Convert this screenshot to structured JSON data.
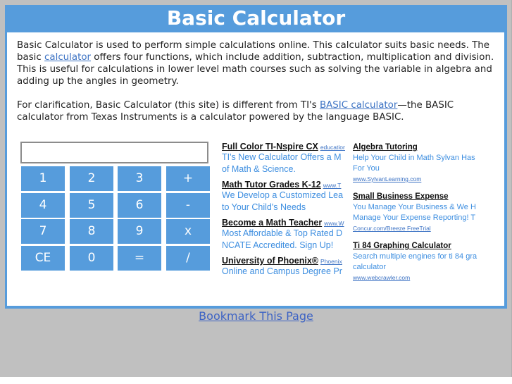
{
  "header": {
    "title": "Basic Calculator"
  },
  "intro": {
    "p1_before": "Basic Calculator is used to perform simple calculations online. This calculator suits basic needs. The basic ",
    "p1_link": "calculator",
    "p1_after": " offers four functions, which include addition, subtraction, multiplication and division. This is useful for calculations in lower level math courses such as solving the variable in algebra and adding up the angles in geometry.",
    "p2_before": "For clarification, Basic Calculator (this site) is different from TI's ",
    "p2_link": "BASIC calculator",
    "p2_after": "—the BASIC calculator from Texas Instruments is a calculator powered by the language BASIC."
  },
  "calculator": {
    "display_value": "",
    "keys": [
      [
        "1",
        "2",
        "3",
        "+"
      ],
      [
        "4",
        "5",
        "6",
        "-"
      ],
      [
        "7",
        "8",
        "9",
        "x"
      ],
      [
        "CE",
        "0",
        "=",
        "/"
      ]
    ]
  },
  "ads_left": [
    {
      "title": "Full Color TI-Nspire CX",
      "domain": "education.ti.com",
      "body": [
        "TI's New Calculator Offers a M",
        "of Math & Science."
      ]
    },
    {
      "title": "Math Tutor Grades K-12",
      "domain": "www.T",
      "body": [
        "We Develop a Customized Lea",
        "to Your Child's Needs"
      ]
    },
    {
      "title": "Become a Math Teacher",
      "domain": "www.W",
      "body": [
        "Most Affordable & Top Rated D",
        "NCATE Accredited. Sign Up!"
      ]
    },
    {
      "title": "University of Phoenix®",
      "domain": "Phoenix",
      "body": [
        "Online and Campus Degree Pr"
      ]
    }
  ],
  "ads_right": [
    {
      "title": "Algebra Tutoring",
      "body": "Help Your Child in Math Sylvan Has For You",
      "url": "www.SylvanLearning.com"
    },
    {
      "title": "Small Business Expense",
      "body": "You Manage Your Business & We H Manage Your Expense Reporting! T",
      "url": "Concur.com/Breeze  FreeTrial"
    },
    {
      "title": "Ti 84 Graphing Calculator",
      "body": "Search multiple engines for ti 84 gra calculator",
      "url": "www.webcrawler.com"
    }
  ],
  "footer": {
    "bookmark_label": "Bookmark This Page"
  },
  "colors": {
    "brand_blue": "#569cdc",
    "page_bg": "#c0c0c0",
    "link": "#3d73c4"
  }
}
